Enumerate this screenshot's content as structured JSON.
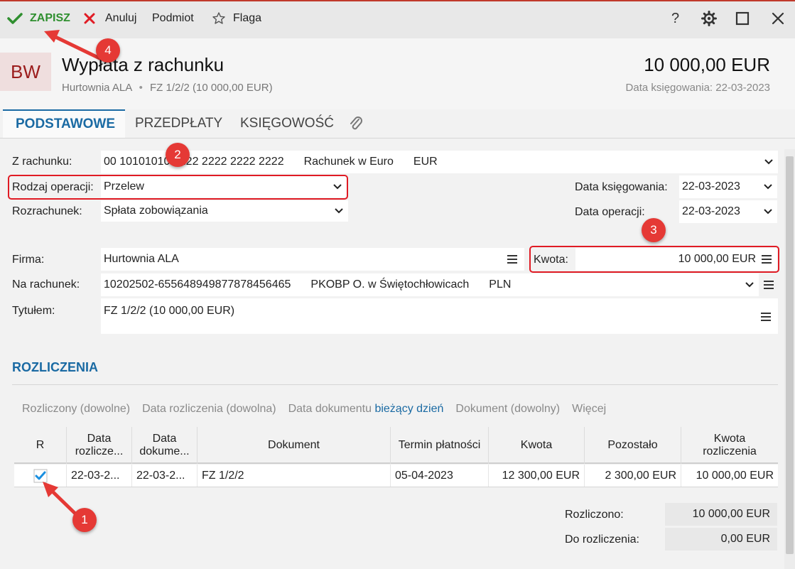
{
  "toolbar": {
    "save_label": "ZAPISZ",
    "cancel_label": "Anuluj",
    "subject_label": "Podmiot",
    "flag_label": "Flaga",
    "help_label": "?"
  },
  "header": {
    "badge": "BW",
    "title": "Wypłata z rachunku",
    "company": "Hurtownia ALA",
    "separator": "•",
    "document_ref": "FZ 1/2/2 (10 000,00 EUR)",
    "amount": "10 000,00 EUR",
    "booking_date": "Data księgowania: 22-03-2023"
  },
  "tabs": [
    {
      "label": "PODSTAWOWE"
    },
    {
      "label": "PRZEDPŁATY"
    },
    {
      "label": "KSIĘGOWOŚĆ"
    }
  ],
  "form": {
    "from_account_label": "Z rachunku:",
    "from_account_number": "00 10101010 2222 2222 2222 2222",
    "from_account_name": "Rachunek w Euro",
    "from_account_currency": "EUR",
    "operation_type_label": "Rodzaj operacji:",
    "operation_type_value": "Przelew",
    "settlement_label": "Rozrachunek:",
    "settlement_value": "Spłata zobowiązania",
    "booking_date_label": "Data księgowania:",
    "booking_date_value": "22-03-2023",
    "operation_date_label": "Data operacji:",
    "operation_date_value": "22-03-2023",
    "company_label": "Firma:",
    "company_value": "Hurtownia ALA",
    "amount_label": "Kwota:",
    "amount_value": "10 000,00 EUR",
    "to_account_label": "Na rachunek:",
    "to_account_number": "10202502-655648949877878456465",
    "to_account_bank": "PKOBP O. w Świętochłowicach",
    "to_account_currency": "PLN",
    "title_label": "Tytułem:",
    "title_value": "FZ 1/2/2 (10 000,00 EUR)"
  },
  "settlements": {
    "section_title": "ROZLICZENIA",
    "filters": {
      "settled": "Rozliczony (dowolne)",
      "settle_date": "Data rozliczenia (dowolna)",
      "doc_date_prefix": "Data dokumentu",
      "doc_date_value": "bieżący dzień",
      "document": "Dokument (dowolny)",
      "more": "Więcej"
    },
    "columns": {
      "r": "R",
      "settle_date_1": "Data",
      "settle_date_2": "rozlicze...",
      "doc_date_1": "Data",
      "doc_date_2": "dokume...",
      "document": "Dokument",
      "due": "Termin płatności",
      "amount": "Kwota",
      "remaining": "Pozostało",
      "settle_amount_1": "Kwota",
      "settle_amount_2": "rozliczenia"
    },
    "rows": [
      {
        "checked": true,
        "settle_date": "22-03-2...",
        "doc_date": "22-03-2...",
        "document": "FZ 1/2/2",
        "due": "05-04-2023",
        "amount": "12 300,00 EUR",
        "remaining": "2 300,00 EUR",
        "settle_amount": "10 000,00 EUR"
      }
    ],
    "settled_label": "Rozliczono:",
    "settled_value": "10 000,00 EUR",
    "to_settle_label": "Do rozliczenia:",
    "to_settle_value": "0,00 EUR"
  },
  "annotations": [
    "1",
    "2",
    "3",
    "4"
  ],
  "colors": {
    "accent": "#1a6aa3",
    "save_green": "#2f8f2f",
    "cancel_red": "#e01b24",
    "annotation_red": "#e53935"
  },
  "icons": [
    "check-icon",
    "close-icon",
    "star-icon",
    "help-icon",
    "gear-icon",
    "maximize-icon",
    "window-close-icon",
    "paperclip-icon",
    "chevron-down-icon",
    "menu-icon",
    "checkbox-checked-icon"
  ]
}
